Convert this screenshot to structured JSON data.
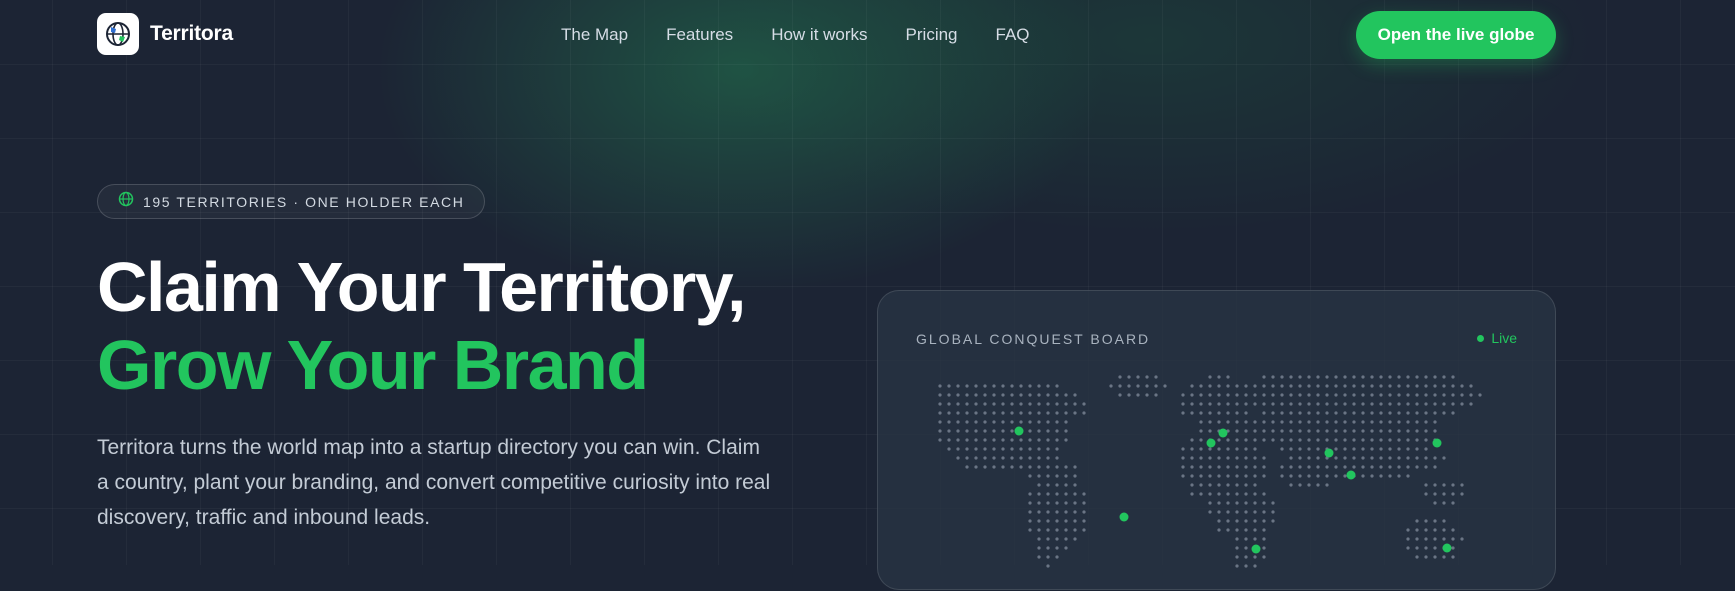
{
  "brand": {
    "name": "Territora",
    "logo_icon": "globe-icon"
  },
  "nav": {
    "links": [
      "The Map",
      "Features",
      "How it works",
      "Pricing",
      "FAQ"
    ],
    "cta": "Open the live globe"
  },
  "hero": {
    "badge": "195 TERRITORIES · ONE HOLDER EACH",
    "badge_icon": "globe-icon",
    "title_line1": "Claim Your Territory,",
    "title_line2": "Grow Your Brand",
    "description": "Territora turns the world map into a startup directory you can win. Claim a country, plant your branding, and convert competitive curiosity into real discovery, traffic and inbound leads."
  },
  "board": {
    "title": "GLOBAL CONQUEST BOARD",
    "status": "Live"
  },
  "colors": {
    "accent": "#22c55e",
    "background": "#1c2434",
    "dot": "#6b7585"
  }
}
